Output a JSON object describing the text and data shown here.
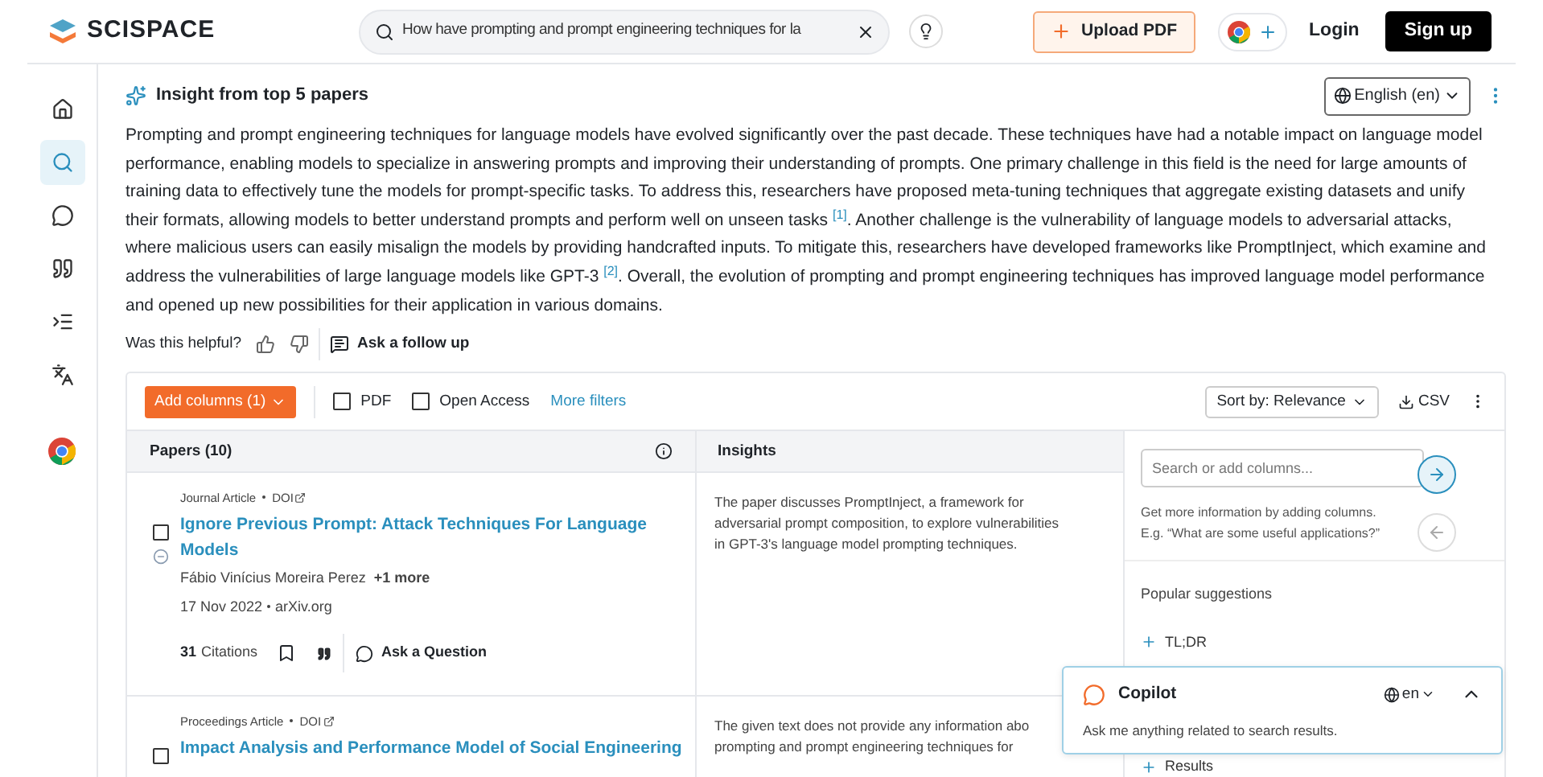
{
  "header": {
    "logo": "SCISPACE",
    "search": {
      "value": "How have prompting and prompt engineering techniques for la"
    },
    "upload": "Upload PDF",
    "login": "Login",
    "signup": "Sign up"
  },
  "sidebar": {
    "items": [
      {
        "kind": "home",
        "selected": false
      },
      {
        "kind": "search",
        "selected": true
      },
      {
        "kind": "chat",
        "selected": false
      },
      {
        "kind": "quote",
        "selected": false
      },
      {
        "kind": "outline",
        "selected": false
      },
      {
        "kind": "translate",
        "selected": false
      },
      {
        "kind": "chrome",
        "selected": false
      }
    ]
  },
  "insight": {
    "title": "Insight from top 5 papers",
    "language": "English (en)",
    "paragraph": "Prompting and prompt engineering techniques for language models have evolved significantly over the past decade. These techniques have had a notable impact on language model performance, enabling models to specialize in answering prompts and improving their understanding of prompts. One primary challenge in this field is the need for large amounts of training data to effectively tune the models for prompt-specific tasks. To address this, researchers have proposed meta-tuning techniques that aggregate existing datasets and unify their formats, allowing models to better understand prompts and perform well on unseen tasks $^{[1]}$. Another challenge is the vulnerability of language models to adversarial attacks, where malicious users can easily misalign the models by providing handcrafted inputs. To mitigate this, researchers have developed frameworks like PromptInject, which examine and address the vulnerabilities of large language models like GPT-3 $^{[2]}$. Overall, the evolution of prompting and prompt engineering techniques has improved language model performance and opened up new possibilities for their application in various domains.",
    "helpful": "Was this helpful?",
    "follow_up": "Ask a follow up"
  },
  "table": {
    "add_columns": "Add columns (1)",
    "filters": [
      {
        "label": "PDF",
        "checked": false
      },
      {
        "label": "Open Access",
        "checked": false
      }
    ],
    "more_filters": "More filters",
    "sort": "Sort by: Relevance",
    "csv": "CSV",
    "columns": [
      "Papers (10)",
      "Insights"
    ],
    "rows": [
      {
        "type": "Journal Article",
        "doi": "DOI",
        "checked": false,
        "title": "Ignore Previous Prompt: Attack Techniques For Language Models",
        "authors": "Fábio Vinícius Moreira Perez",
        "more": "+1 more",
        "date": "17 Nov 2022",
        "venue": "arXiv.org",
        "citations": "31",
        "citations_label": "Citations",
        "ask": "Ask a Question",
        "insight_lines": [
          "The paper discusses PromptInject, a framework for",
          "adversarial prompt composition, to explore vulnerabilities",
          "in GPT-3's language model prompting techniques."
        ]
      },
      {
        "type": "Proceedings Article",
        "doi": "DOI",
        "checked": false,
        "title": "Impact Analysis and Performance Model of Social Engineering",
        "insight_lines": [
          "The given text does not provide any information abo",
          "prompting and prompt engineering techniques for"
        ]
      }
    ]
  },
  "column_panel": {
    "placeholder": "Search or add columns...",
    "hint": "Get more information by adding columns.",
    "example": "E.g. “What are some useful applications?”",
    "popular": "Popular suggestions",
    "suggestions": [
      "TL;DR",
      "Results"
    ]
  },
  "copilot": {
    "title": "Copilot",
    "language": "en",
    "prompt": "Ask me anything related to search results."
  }
}
